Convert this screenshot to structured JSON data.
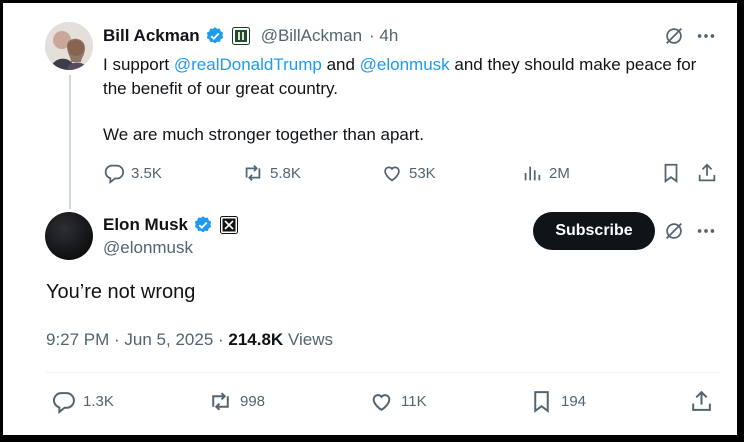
{
  "parent_tweet": {
    "name": "Bill Ackman",
    "handle": "@BillAckman",
    "time": "· 4h",
    "text_part1": "I support ",
    "mention1": "@realDonaldTrump",
    "text_part2": " and ",
    "mention2": "@elonmusk",
    "text_part3": " and they should make peace for the benefit of our great country.",
    "paragraph2": "We are much stronger together than apart.",
    "actions": {
      "replies": "3.5K",
      "reposts": "5.8K",
      "likes": "53K",
      "views": "2M"
    }
  },
  "main_tweet": {
    "name": "Elon Musk",
    "handle": "@elonmusk",
    "subscribe_label": "Subscribe",
    "text": "You’re not wrong",
    "timestamp": "9:27 PM · Jun 5, 2025 · ",
    "view_count": "214.8K",
    "views_label": " Views",
    "actions": {
      "replies": "1.3K",
      "reposts": "998",
      "likes": "11K",
      "bookmarks": "194"
    }
  },
  "colors": {
    "accent": "#1d9bf0",
    "text": "#0f1419",
    "muted": "#536471",
    "verified": "#1d9bf0"
  }
}
